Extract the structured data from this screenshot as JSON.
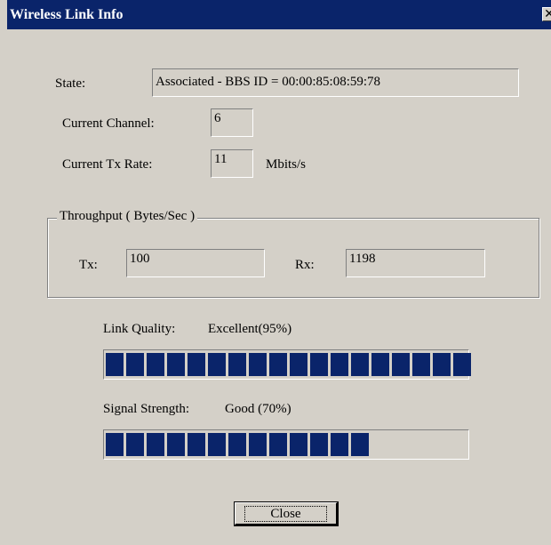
{
  "window": {
    "title": "Wireless Link Info",
    "close_glyph": "✕"
  },
  "state": {
    "label": "State:",
    "value": "Associated - BBS ID = 00:00:85:08:59:78"
  },
  "channel": {
    "label": "Current Channel:",
    "value": "6"
  },
  "tx_rate": {
    "label": "Current Tx Rate:",
    "value": "11",
    "unit": "Mbits/s"
  },
  "throughput": {
    "title": "Throughput ( Bytes/Sec )",
    "tx_label": "Tx:",
    "tx_value": "100",
    "rx_label": "Rx:",
    "rx_value": "1198"
  },
  "link_quality": {
    "label": "Link Quality:",
    "value_text": "Excellent(95%)",
    "percent": 95,
    "blocks": 18
  },
  "signal_strength": {
    "label": "Signal Strength:",
    "value_text": "Good (70%)",
    "percent": 70,
    "blocks": 13
  },
  "buttons": {
    "close": "Close"
  },
  "colors": {
    "title_bar": "#0a246a",
    "dialog_bg": "#d4d0c8",
    "meter_fill": "#0a246a"
  }
}
